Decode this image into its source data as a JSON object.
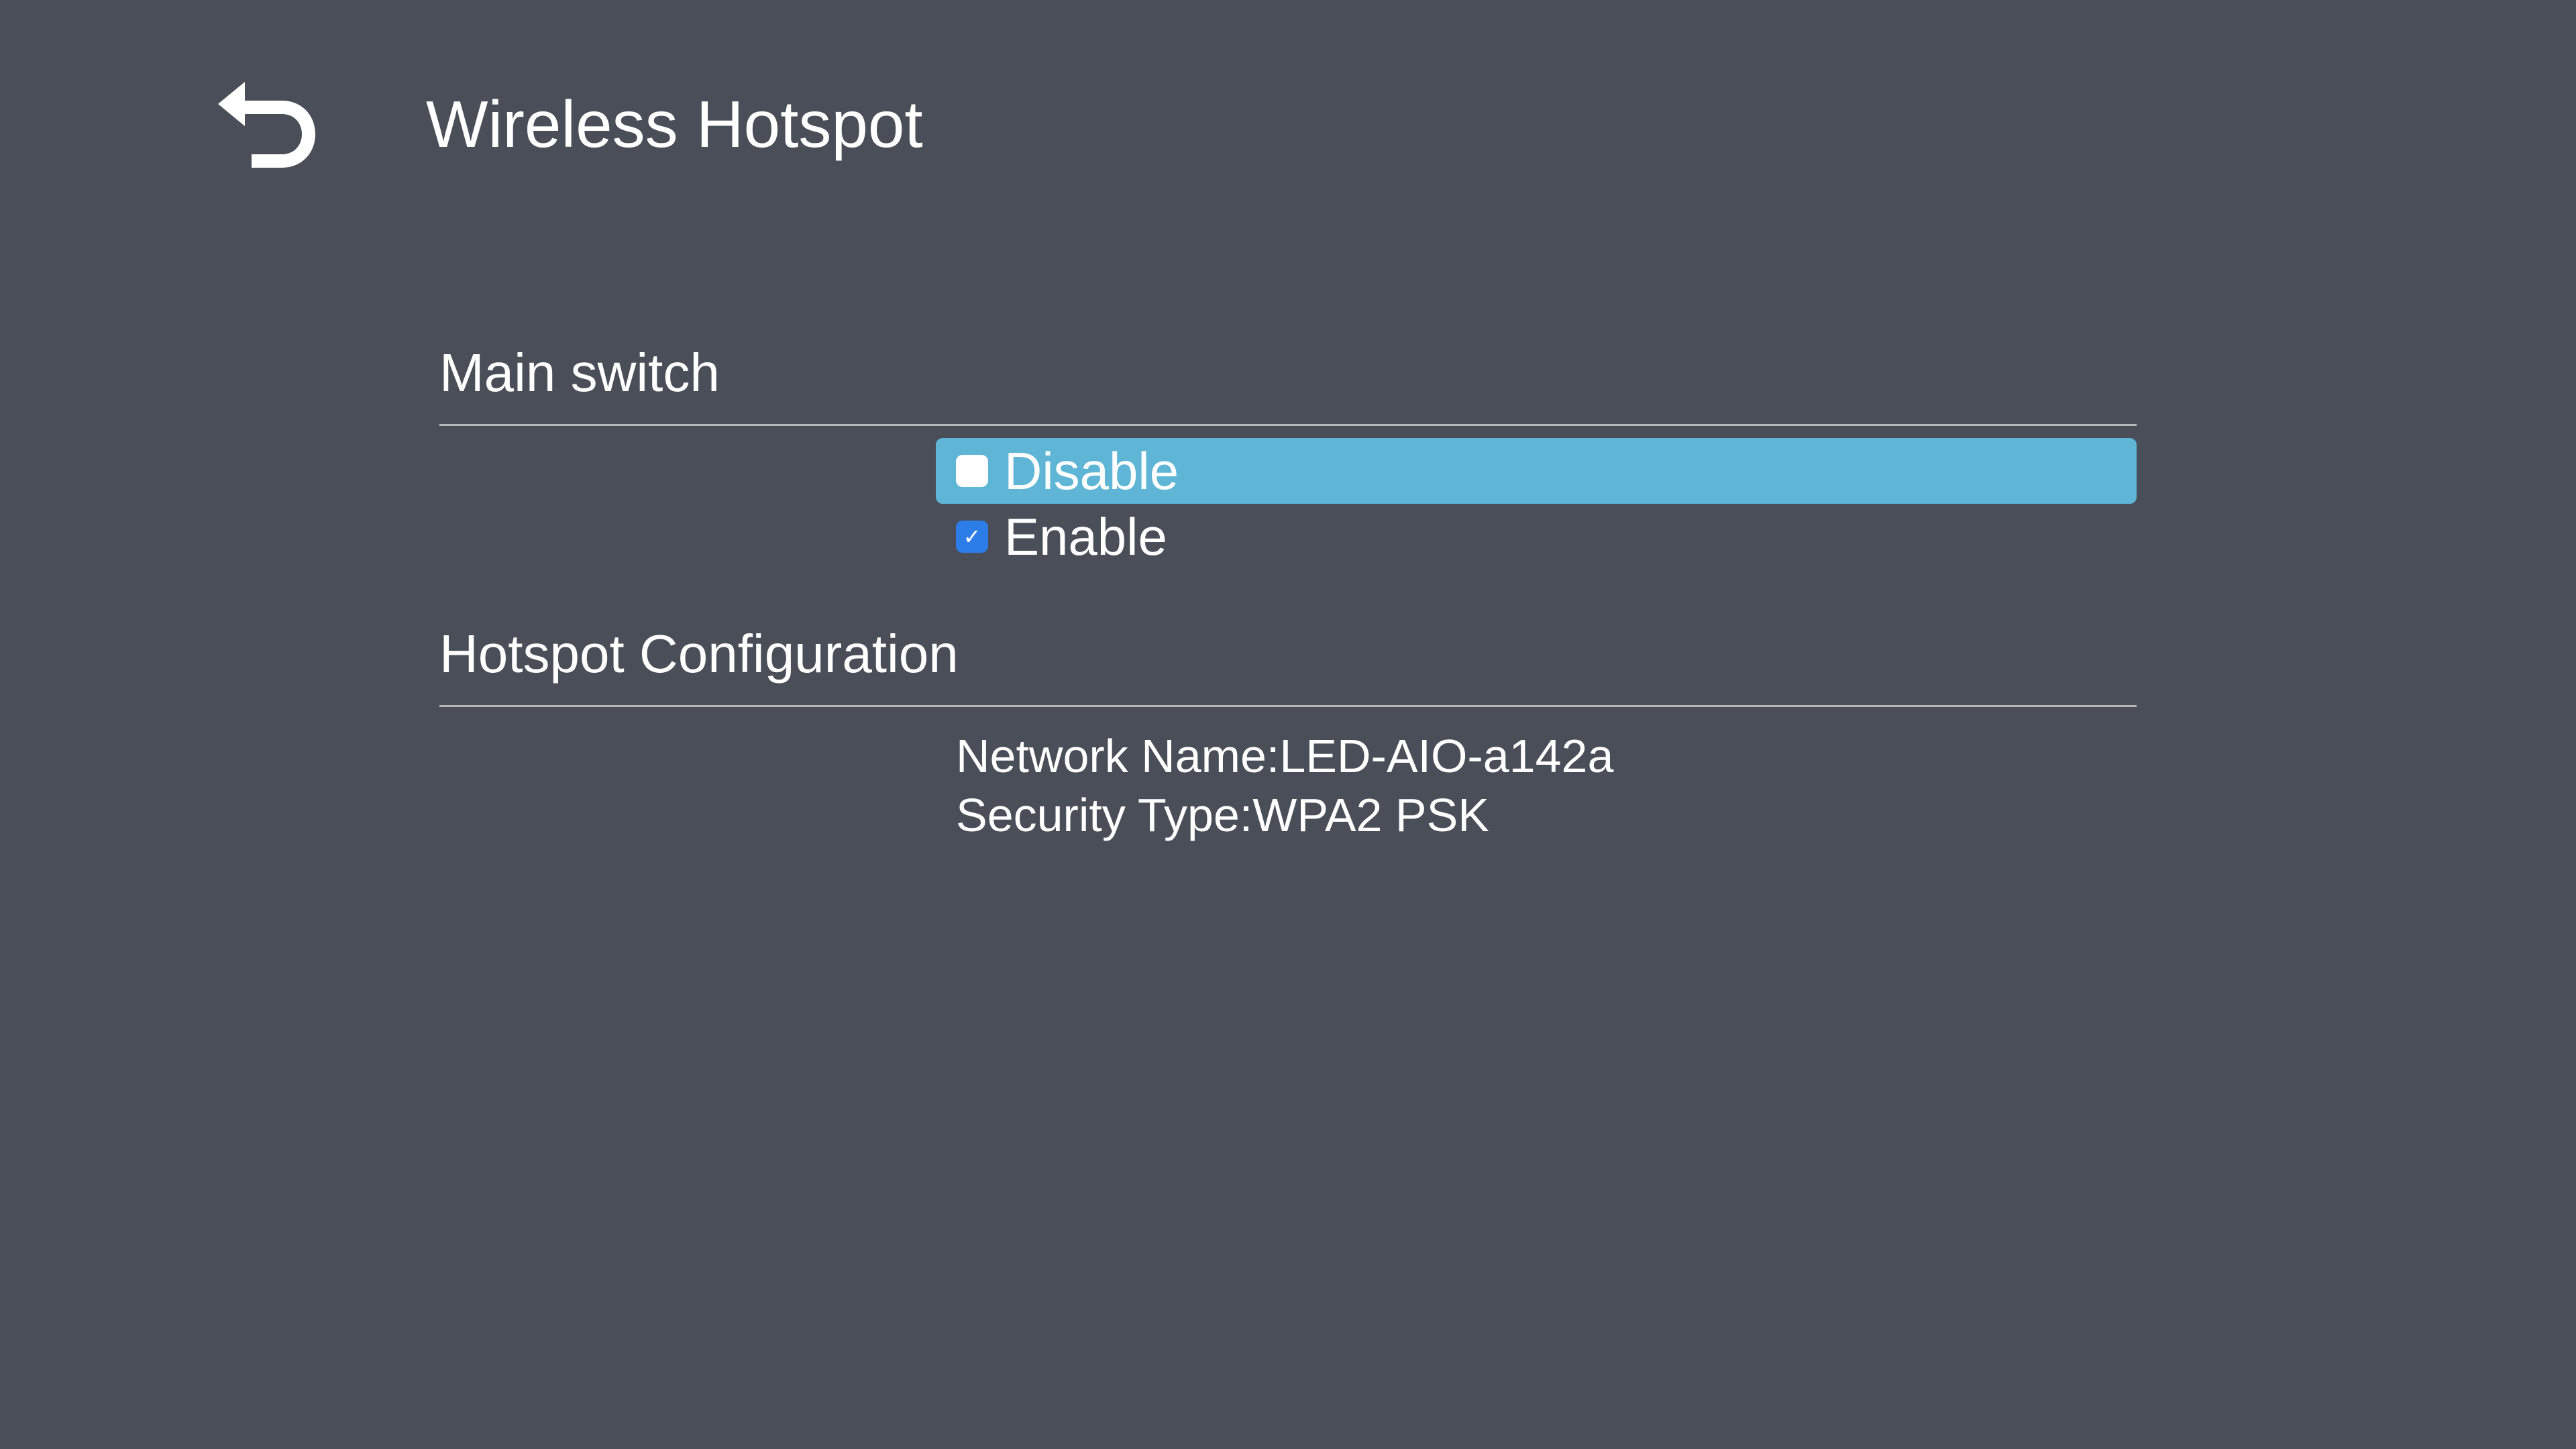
{
  "header": {
    "title": "Wireless Hotspot"
  },
  "sections": {
    "mainSwitch": {
      "title": "Main switch",
      "options": {
        "disable": {
          "label": "Disable",
          "checked": false,
          "highlighted": true
        },
        "enable": {
          "label": "Enable",
          "checked": true,
          "highlighted": false
        }
      }
    },
    "hotspotConfig": {
      "title": "Hotspot Configuration",
      "networkName": {
        "label": "Network Name:",
        "value": "LED-AIO-a142a"
      },
      "securityType": {
        "label": "Security Type:",
        "value": "WPA2 PSK"
      }
    }
  }
}
